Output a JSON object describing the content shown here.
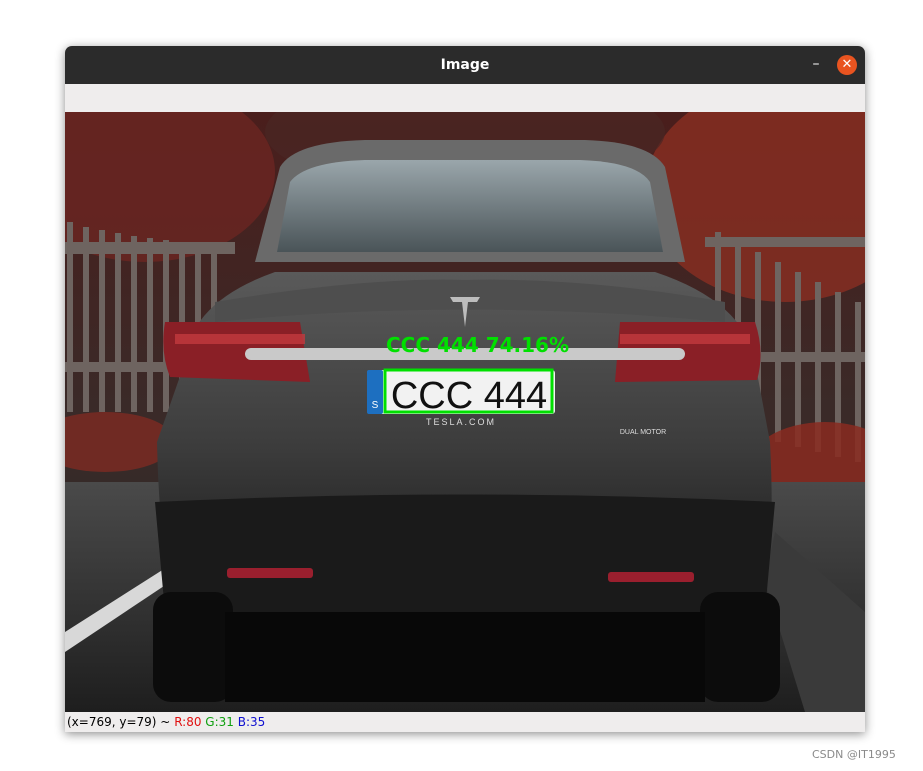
{
  "window": {
    "title": "Image",
    "minimize_glyph": "–",
    "close_glyph": "✕"
  },
  "image": {
    "detection_label": "CCC 444 74.16%",
    "plate_text": "CCC 444",
    "plate_country": "S",
    "plate_frame_text": "TESLA.COM",
    "badge_text": "DUAL MOTOR",
    "detection_color": "#00e000"
  },
  "status": {
    "coords": "(x=769, y=79) ~",
    "r": "R:80",
    "g": "G:31",
    "b": "B:35"
  },
  "watermark": "CSDN @IT1995"
}
